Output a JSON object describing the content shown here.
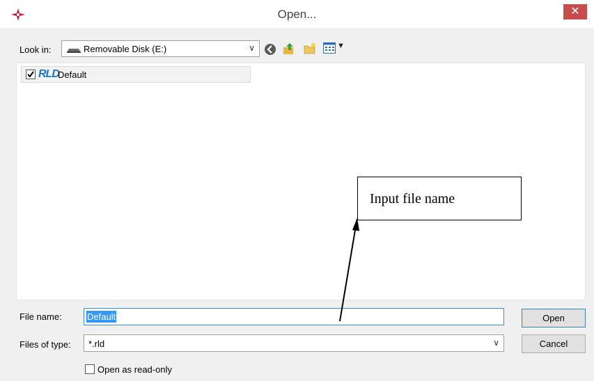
{
  "window": {
    "title": "Open...",
    "close_glyph": "✕",
    "app_icon": "compass-star-icon"
  },
  "toolbar": {
    "look_in_label": "Look in:",
    "look_in_value": "Removable Disk (E:)",
    "icons": [
      "back-icon",
      "up-folder-icon",
      "new-folder-icon",
      "view-menu-icon"
    ]
  },
  "file_list": {
    "items": [
      {
        "logo": "RLD",
        "label": "Default",
        "checked": true
      }
    ]
  },
  "annotation": {
    "callout_text": "Input file name"
  },
  "footer": {
    "file_name_label": "File name:",
    "file_name_value": "Default",
    "file_type_label": "Files of type:",
    "file_type_value": "*.rld",
    "read_only_label": "Open as read-only",
    "read_only_checked": false,
    "open_button": "Open",
    "cancel_button": "Cancel"
  },
  "colors": {
    "close_bg": "#c74c4c",
    "selection": "#3399ff",
    "rld_blue": "#1f7ac4",
    "app_icon_red": "#c8102e"
  }
}
